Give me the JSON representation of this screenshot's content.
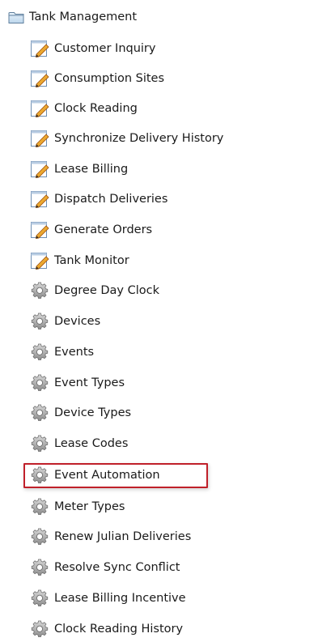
{
  "tree": {
    "root": {
      "label": "Tank Management",
      "icon": "folder-icon"
    },
    "items": [
      {
        "label": "Customer Inquiry",
        "icon": "edit-form-icon"
      },
      {
        "label": "Consumption Sites",
        "icon": "edit-form-icon"
      },
      {
        "label": "Clock Reading",
        "icon": "edit-form-icon"
      },
      {
        "label": "Synchronize Delivery History",
        "icon": "edit-form-icon"
      },
      {
        "label": "Lease Billing",
        "icon": "edit-form-icon"
      },
      {
        "label": "Dispatch Deliveries",
        "icon": "edit-form-icon"
      },
      {
        "label": "Generate Orders",
        "icon": "edit-form-icon"
      },
      {
        "label": "Tank Monitor",
        "icon": "edit-form-icon"
      },
      {
        "label": "Degree Day Clock",
        "icon": "gear-icon"
      },
      {
        "label": "Devices",
        "icon": "gear-icon"
      },
      {
        "label": "Events",
        "icon": "gear-icon"
      },
      {
        "label": "Event Types",
        "icon": "gear-icon"
      },
      {
        "label": "Device Types",
        "icon": "gear-icon"
      },
      {
        "label": "Lease Codes",
        "icon": "gear-icon"
      },
      {
        "label": "Event Automation",
        "icon": "gear-icon",
        "highlighted": true
      },
      {
        "label": "Meter Types",
        "icon": "gear-icon"
      },
      {
        "label": "Renew Julian Deliveries",
        "icon": "gear-icon"
      },
      {
        "label": "Resolve Sync Conflict",
        "icon": "gear-icon"
      },
      {
        "label": "Lease Billing Incentive",
        "icon": "gear-icon"
      },
      {
        "label": "Clock Reading History",
        "icon": "gear-icon"
      }
    ]
  },
  "colors": {
    "highlight_border": "#c0202a",
    "text": "#1a1a1a"
  }
}
